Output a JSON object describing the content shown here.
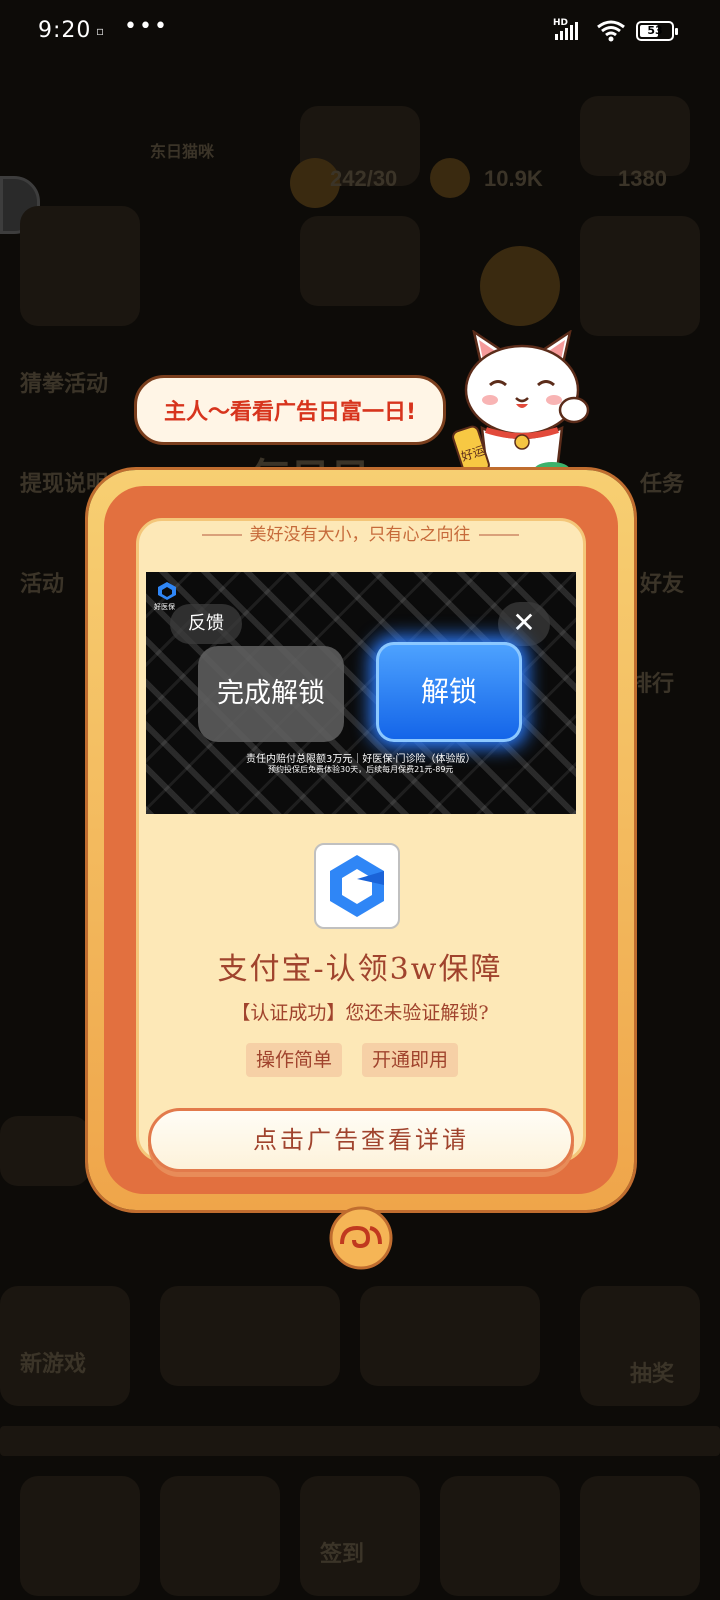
{
  "status_bar": {
    "time": "9:20",
    "small_icon": "▫",
    "dots": "•••",
    "network": "HD",
    "battery": "53"
  },
  "speech_bubble": "主人～看看广告日富一日!",
  "mascot": {
    "badge_text": "好运",
    "icon": "lucky-cat-icon"
  },
  "modal": {
    "motto": "美好没有大小，只有心之向往",
    "ad": {
      "logo_text": "好医保",
      "feedback_label": "反馈",
      "close_label": "✕",
      "done_button": "完成解锁",
      "unlock_button": "解锁",
      "fine_print_1": "责任内赔付总限额3万元｜好医保·门诊险（体验版）",
      "fine_print_2": "预约投保后免费体验30天，后续每月保费21元-89元"
    },
    "app_name": "支付宝-认领3w保障",
    "app_desc": "【认证成功】您还未验证解锁?",
    "tags": [
      "操作简单",
      "开通即用"
    ],
    "cta": "点击广告查看详请"
  },
  "colors": {
    "frame_orange": "#e2703f",
    "frame_gold": "#f7cf72",
    "card_bg": "#fde8b7",
    "text_brown": "#a0432d",
    "unlock_blue": "#1263e8"
  }
}
